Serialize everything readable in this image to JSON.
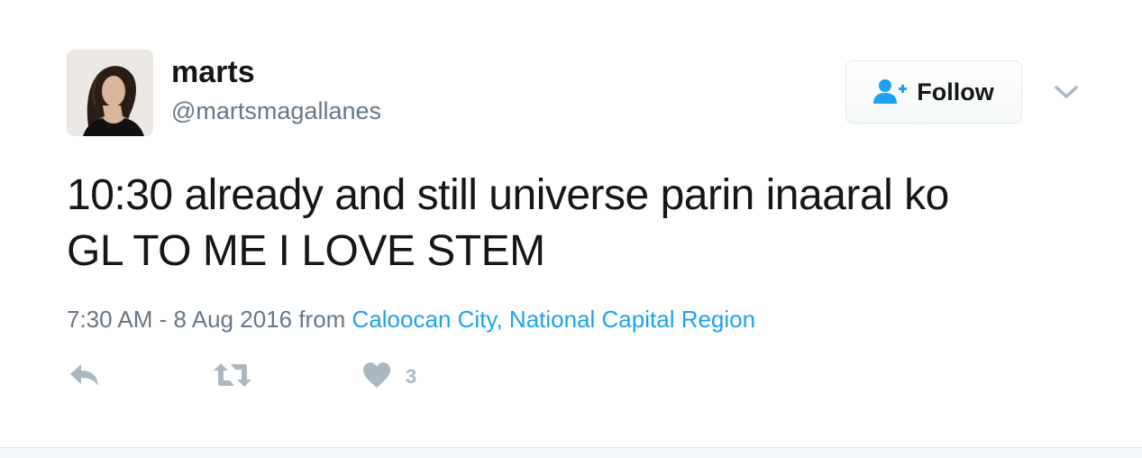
{
  "user": {
    "display_name": "marts",
    "handle": "@martsmagallanes",
    "avatar_icon": "profile-photo"
  },
  "follow_button": {
    "label": "Follow",
    "icon": "add-user-icon"
  },
  "menu": {
    "icon": "chevron-down-icon"
  },
  "tweet": {
    "line1": "10:30 already and still universe parin inaaral ko",
    "line2": "GL TO ME I LOVE STEM"
  },
  "meta": {
    "timestamp": "7:30 AM - 8 Aug 2016",
    "from_label": "from",
    "location": "Caloocan City, National Capital Region"
  },
  "actions": {
    "reply_icon": "reply-icon",
    "retweet_icon": "retweet-icon",
    "like_icon": "heart-icon",
    "like_count": "3"
  },
  "colors": {
    "accent": "#1da1f2",
    "muted": "#657786",
    "icon_gray": "#aab8c2",
    "text": "#14171a"
  }
}
